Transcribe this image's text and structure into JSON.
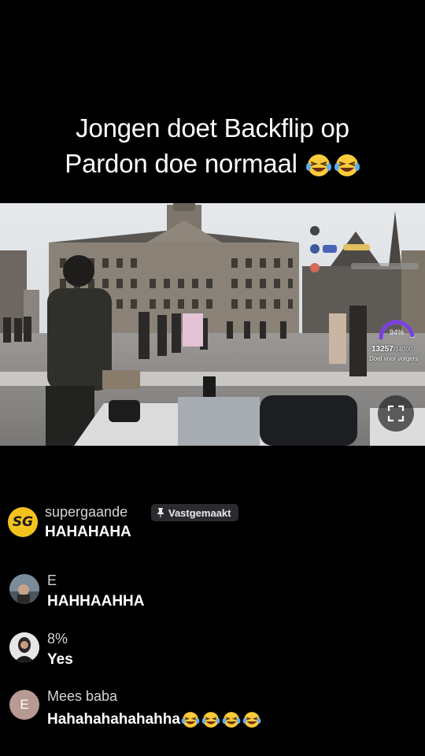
{
  "caption": {
    "line1": "Jongen doet Backflip op",
    "line2": "Pardon doe normaal",
    "emoji": [
      "grinning-squinting-face-with-tears",
      "grinning-squinting-face-with-tears"
    ]
  },
  "video": {
    "goal_count": "13257",
    "goal_target": "/14000",
    "goal_label": "Doel voor volgers",
    "goal_progress": 0.947,
    "goal_percent": "94%"
  },
  "chat": {
    "messages": [
      {
        "user": "supergaande",
        "text": "HAHAHAHA",
        "pinned_label": "Vastgemaakt",
        "avatar": "SG",
        "avatar_color": "#f4c21f"
      },
      {
        "user": "E",
        "text": "HAHHAAHHA",
        "avatar": "photo-avatar"
      },
      {
        "user": "8%",
        "text": "Yes",
        "avatar": "photo-avatar"
      },
      {
        "user": "Mees baba",
        "text": "Hahahahahahahha",
        "avatar": "E",
        "avatar_color": "#b79a93",
        "emoji_count": 4
      }
    ]
  },
  "icons": {
    "fullscreen": "fullscreen-icon",
    "pin": "pin-icon"
  }
}
